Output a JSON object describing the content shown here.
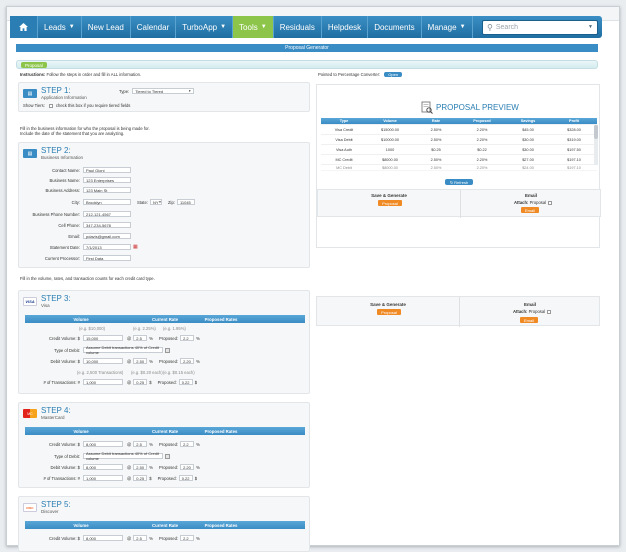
{
  "nav": {
    "home_icon": "home-icon",
    "items": [
      {
        "label": "Leads",
        "caret": true
      },
      {
        "label": "New Lead",
        "caret": false
      },
      {
        "label": "Calendar",
        "caret": false
      },
      {
        "label": "TurboApp",
        "caret": true
      },
      {
        "label": "Tools",
        "caret": true,
        "active": true
      },
      {
        "label": "Residuals",
        "caret": false
      },
      {
        "label": "Helpdesk",
        "caret": false
      },
      {
        "label": "Documents",
        "caret": false
      },
      {
        "label": "Manage",
        "caret": true
      }
    ],
    "search_placeholder": "Search"
  },
  "title": "Proposal Generator",
  "tab": "Proposal",
  "instructions_bold": "Instructions:",
  "instructions": "Follow the steps in order and fill in ALL information.",
  "step1": {
    "title": "STEP 1:",
    "sub": "Application Information",
    "type_label": "Type:",
    "type_value": "Tiered to Tiered",
    "show_label": "Show Tiers:",
    "show_text": "check this box if you require tiered fields"
  },
  "fill_text_1": "Fill in the business information for who the proposal is being made for.",
  "fill_text_2": "Include the date of the statement that you are analyzing.",
  "step2": {
    "title": "STEP 2:",
    "sub": "Business Information",
    "contact_label": "Contact Name:",
    "contact": "Paul Gioni",
    "business_label": "Business Name:",
    "business": "123 Enterprises",
    "address_label": "Business Address:",
    "address": "123 Main St",
    "city_label": "City:",
    "city": "Brooklyn",
    "state_label": "State:",
    "state": "NY",
    "zip_label": "Zip:",
    "zip": "11045",
    "bphone_label": "Business Phone Number:",
    "bphone": "212-121-4567",
    "cell_label": "Cell Phone:",
    "cell": "347-234-5678",
    "email_label": "Email:",
    "email": "pdavis@gmail.com",
    "date_label": "Statement Date:",
    "date": "7/1/2013",
    "processor_label": "Current Processor:",
    "processor": "First Data"
  },
  "fill_text_3": "Fill in the volume, rates, and transaction counts for each credit card type.",
  "table_headers": {
    "volume": "Volume",
    "current": "Current Rate",
    "proposed": "Proposed Rates"
  },
  "step3": {
    "title": "STEP 3:",
    "sub": "Visa",
    "logo": "VISA",
    "eg1": "(e.g. $10,000)",
    "eg2": "(e.g. 2.25%)",
    "eg3": "(e.g. 1.95%)",
    "credit_label": "Credit Volume: $",
    "credit": "15,000",
    "credit_rate": "2.5",
    "credit_prop": "2.2",
    "debit_type_label": "Type of Debit:",
    "debit_type": "Assume Debit transactions 40% of Credit volume",
    "debit_label": "Debit Volume: $",
    "debit": "10,000",
    "debit_rate": "2.50",
    "debit_prop": "2.20",
    "eg4": "(e.g. 2,500 Transactions)",
    "eg5": "(e.g. $0.20 each)",
    "eg6": "(e.g. $0.15 each)",
    "trans_label": "# of Transactions: #",
    "trans": "1,000",
    "trans_rate": "0.25",
    "trans_prop": "0.22"
  },
  "step4": {
    "title": "STEP 4:",
    "sub": "MasterCard",
    "logo": "MC",
    "credit_label": "Credit Volume: $",
    "credit": "8,000",
    "credit_rate": "2.5",
    "credit_prop": "2.2",
    "debit_type_label": "Type of Debit:",
    "debit_type": "Assume Debit transactions 40% of Credit volume",
    "debit_label": "Debit Volume: $",
    "debit": "8,000",
    "debit_rate": "2.50",
    "debit_prop": "2.20",
    "trans_label": "# of Transactions: #",
    "trans": "1,000",
    "trans_rate": "0.25",
    "trans_prop": "0.22"
  },
  "step5": {
    "title": "STEP 5:",
    "sub": "Discover",
    "logo": "DISC",
    "credit_label": "Credit Volume: $",
    "credit": "8,000",
    "credit_rate": "2.5",
    "credit_prop": "2.2"
  },
  "symbols": {
    "at": "@",
    "pct": "%",
    "proposed": "Proposed:",
    "dollar": "$"
  },
  "right": {
    "points_label": "Pointed to Percentage Converter:",
    "open_btn": "Open",
    "preview_title": "PROPOSAL PREVIEW",
    "cols": [
      "Type",
      "Volume",
      "Rate",
      "Proposed",
      "Savings",
      "Profit"
    ],
    "rows": [
      [
        "Visa Credit",
        "$15000.00",
        "2.50%",
        "2.20%",
        "$45.00",
        "$328.00"
      ],
      [
        "Visa Debit",
        "$10000.00",
        "2.50%",
        "2.20%",
        "$30.00",
        "$319.00"
      ],
      [
        "Visa Auth",
        "1000",
        "$0.25",
        "$0.22",
        "$30.00",
        "$197.50"
      ],
      [
        "MC Credit",
        "$8000.00",
        "2.50%",
        "2.20%",
        "$27.00",
        "$197.10"
      ],
      [
        "MC Debit",
        "$8000.00",
        "2.50%",
        "2.20%",
        "$24.00",
        "$197.10"
      ]
    ],
    "refresh": "Refresh",
    "save_title": "Save & Generate",
    "proposal_btn": "Proposal",
    "email_title": "Email",
    "attach_label": "Attach:",
    "attach_value": "Proposal",
    "email_btn": "Email"
  }
}
